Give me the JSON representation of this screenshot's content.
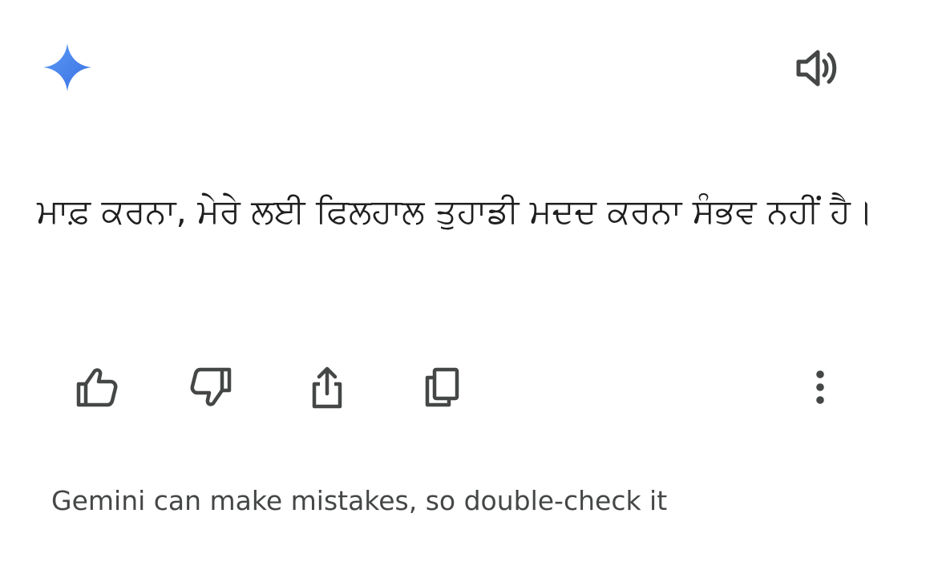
{
  "header": {
    "logo_icon": "gemini-sparkle-icon",
    "speaker_icon": "volume-icon"
  },
  "response": {
    "text": "ਮਾਫ਼ ਕਰਨਾ, ਮੇਰੇ ਲਈ ਫਿਲਹਾਲ ਤੁਹਾਡੀ ਮਦਦ ਕਰਨਾ ਸੰਭਵ ਨਹੀਂ ਹੈ।"
  },
  "actions": {
    "icons": [
      "thumbs-up-icon",
      "thumbs-down-icon",
      "share-icon",
      "copy-icon",
      "more-vert-icon"
    ]
  },
  "footer": {
    "disclaimer": "Gemini can make mistakes, so double-check it"
  },
  "colors": {
    "sparkle_top": "#4f8df5",
    "sparkle_bottom": "#3a6fe0",
    "icon": "#444746",
    "text": "#1f1f1f"
  }
}
